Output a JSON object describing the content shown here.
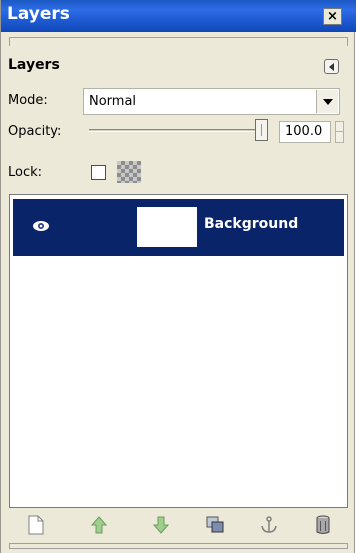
{
  "window": {
    "title": "Layers",
    "close_label": "×"
  },
  "panel": {
    "title": "Layers"
  },
  "mode": {
    "label": "Mode:",
    "value": "Normal"
  },
  "opacity": {
    "label": "Opacity:",
    "value": "100.0",
    "slider_fraction": 1.0
  },
  "lock": {
    "label": "Lock:",
    "alpha_locked": false
  },
  "layers": [
    {
      "name": "Background",
      "visible": true,
      "selected": true
    }
  ],
  "toolbar": {
    "buttons": [
      {
        "icon": "new-layer-icon"
      },
      {
        "icon": "raise-layer-icon"
      },
      {
        "icon": "lower-layer-icon"
      },
      {
        "icon": "duplicate-layer-icon"
      },
      {
        "icon": "anchor-layer-icon"
      },
      {
        "icon": "delete-layer-icon"
      }
    ]
  },
  "colors": {
    "title_bar": "#1a58c2",
    "selection": "#0a246a",
    "dialog_bg": "#ece9d8"
  }
}
